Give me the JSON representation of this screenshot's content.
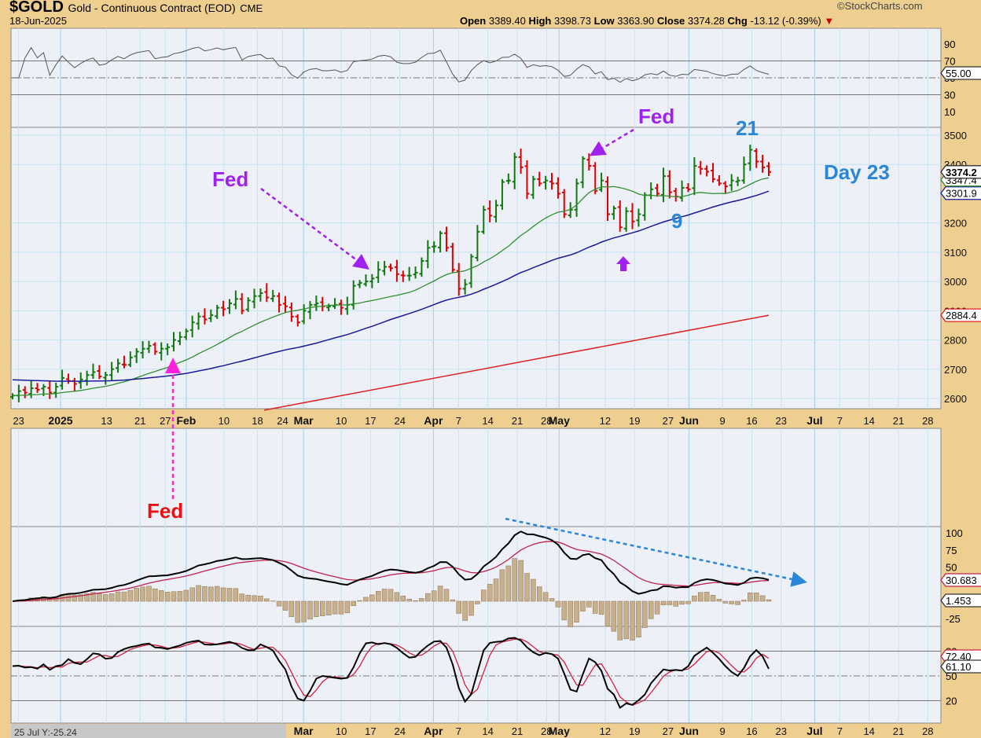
{
  "header": {
    "symbol": "$GOLD",
    "name": "Gold - Continuous Contract (EOD)",
    "exchange": "CME",
    "date": "18-Jun-2025",
    "brand": "©StockCharts.com",
    "open_label": "Open",
    "open": "3389.40",
    "high_label": "High",
    "high": "3398.73",
    "low_label": "Low",
    "low": "3363.90",
    "close_label": "Close",
    "close": "3374.28",
    "chg_label": "Chg",
    "chg": "-13.12 (-0.39%)",
    "down_color": "#cc0000"
  },
  "chart_data": {
    "type": "ohlc",
    "title": "$GOLD Gold - Continuous Contract (EOD) CME",
    "first_bar_date": "2024-12-19",
    "last_bar_date": "2025-06-18",
    "closes": [
      2610,
      2625,
      2620,
      2635,
      2630,
      2640,
      2620,
      2640,
      2670,
      2660,
      2650,
      2665,
      2680,
      2690,
      2675,
      2680,
      2700,
      2720,
      2715,
      2740,
      2760,
      2770,
      2780,
      2760,
      2770,
      2775,
      2800,
      2810,
      2830,
      2860,
      2880,
      2870,
      2885,
      2910,
      2905,
      2925,
      2940,
      2900,
      2935,
      2950,
      2960,
      2945,
      2950,
      2920,
      2915,
      2880,
      2860,
      2900,
      2920,
      2925,
      2915,
      2915,
      2920,
      2910,
      2920,
      2985,
      2995,
      3000,
      3010,
      3040,
      3050,
      3045,
      3025,
      3020,
      3020,
      3030,
      3070,
      3115,
      3120,
      3165,
      3115,
      3040,
      2975,
      2990,
      3085,
      3170,
      3245,
      3225,
      3260,
      3340,
      3345,
      3425,
      3390,
      3300,
      3350,
      3335,
      3345,
      3335,
      3300,
      3230,
      3245,
      3335,
      3420,
      3395,
      3310,
      3345,
      3230,
      3250,
      3185,
      3240,
      3205,
      3230,
      3295,
      3315,
      3300,
      3360,
      3305,
      3290,
      3320,
      3315,
      3395,
      3385,
      3375,
      3350,
      3335,
      3325,
      3345,
      3345,
      3400,
      3450,
      3410,
      3390,
      3374.28
    ],
    "ma50_seed": 2665,
    "ma200": {
      "start_date": "2025-03-01",
      "start_value": 2560,
      "end_value": 2884.4
    },
    "price_axis": {
      "ticks": [
        3500,
        3400,
        3200,
        3100,
        3000,
        2900,
        2800,
        2700,
        2600
      ],
      "range": [
        2575,
        3530
      ]
    },
    "price_labels": {
      "close": "3374.2",
      "ma20": "3347.4",
      "ma50": "3301.9",
      "ma200": "2884.4"
    },
    "rsi": {
      "ticks": [
        "90",
        "70",
        "50",
        "30",
        "10"
      ],
      "value_label": "55.00"
    },
    "macd": {
      "ticks": [
        "100",
        "75",
        "50",
        "-25"
      ],
      "value_label": "30.683",
      "hist_label": "1.453"
    },
    "stoch": {
      "ticks": [
        "80",
        "50",
        "20"
      ],
      "k_label": "72.40",
      "d_label": "61.10"
    },
    "date_labels": [
      {
        "t": "23",
        "d": "2024-12-23"
      },
      {
        "t": "2025",
        "d": "2025-01-02",
        "b": true
      },
      {
        "t": "13",
        "d": "2025-01-13"
      },
      {
        "t": "21",
        "d": "2025-01-21"
      },
      {
        "t": "27",
        "d": "2025-01-27"
      },
      {
        "t": "Feb",
        "d": "2025-02-01",
        "b": true
      },
      {
        "t": "10",
        "d": "2025-02-10"
      },
      {
        "t": "18",
        "d": "2025-02-18"
      },
      {
        "t": "24",
        "d": "2025-02-24"
      },
      {
        "t": "Mar",
        "d": "2025-03-01",
        "b": true
      },
      {
        "t": "10",
        "d": "2025-03-10"
      },
      {
        "t": "17",
        "d": "2025-03-17"
      },
      {
        "t": "24",
        "d": "2025-03-24"
      },
      {
        "t": "Apr",
        "d": "2025-04-01",
        "b": true
      },
      {
        "t": "7",
        "d": "2025-04-07"
      },
      {
        "t": "14",
        "d": "2025-04-14"
      },
      {
        "t": "21",
        "d": "2025-04-21"
      },
      {
        "t": "28",
        "d": "2025-04-28"
      },
      {
        "t": "May",
        "d": "2025-05-01",
        "b": true
      },
      {
        "t": "12",
        "d": "2025-05-12"
      },
      {
        "t": "19",
        "d": "2025-05-19"
      },
      {
        "t": "27",
        "d": "2025-05-27"
      },
      {
        "t": "Jun",
        "d": "2025-06-01",
        "b": true
      },
      {
        "t": "9",
        "d": "2025-06-09"
      },
      {
        "t": "16",
        "d": "2025-06-16"
      },
      {
        "t": "23",
        "d": "2025-06-23"
      },
      {
        "t": "Jul",
        "d": "2025-07-01",
        "b": true
      },
      {
        "t": "7",
        "d": "2025-07-07"
      },
      {
        "t": "14",
        "d": "2025-07-14"
      },
      {
        "t": "21",
        "d": "2025-07-21"
      },
      {
        "t": "28",
        "d": "2025-07-28"
      }
    ],
    "cursor_readout": "25 Jul Y:-25.24",
    "annotations": {
      "fed1": "Fed",
      "fed2": "Fed",
      "fed3": "Fed",
      "count21": "21",
      "count9": "9",
      "day": "Day 23"
    },
    "colors": {
      "up": "#117711",
      "down": "#dd0000",
      "ma20": "#2f8f2f",
      "ma50": "#1a1a99",
      "ma200": "#dd2222",
      "purple": "#a020f0",
      "blue": "#2a86d8",
      "magenta": "#ff22dd"
    }
  }
}
